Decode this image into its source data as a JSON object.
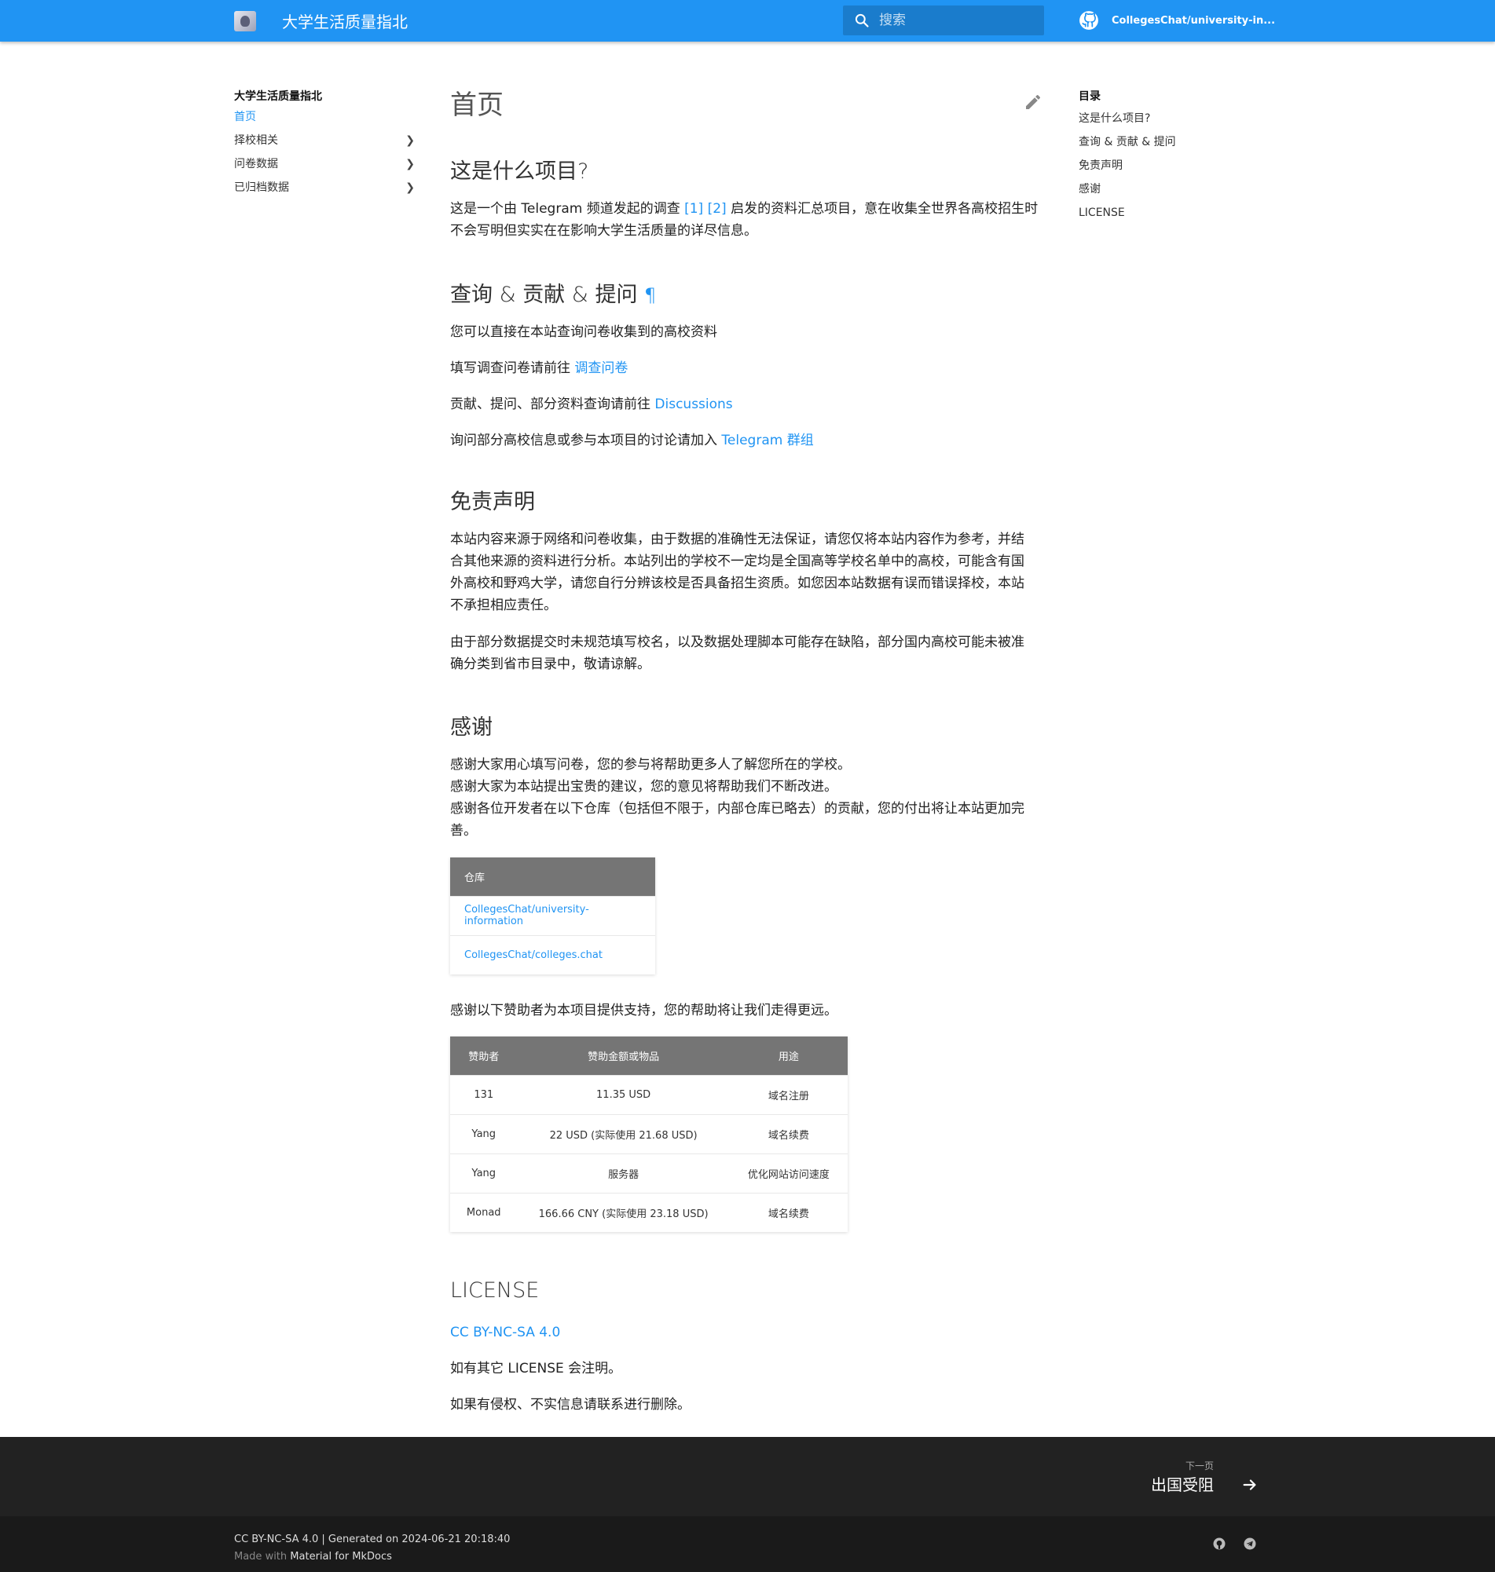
{
  "header": {
    "site_title": "大学生活质量指北",
    "search_placeholder": "搜索",
    "repo_name": "CollegesChat/university-in..."
  },
  "nav": {
    "title": "大学生活质量指北",
    "items": [
      {
        "label": "首页",
        "active": true
      },
      {
        "label": "择校相关"
      },
      {
        "label": "问卷数据"
      },
      {
        "label": "已归档数据"
      }
    ]
  },
  "toc": {
    "title": "目录",
    "items": [
      "这是什么项目?",
      "查询 & 贡献 & 提问",
      "免责声明",
      "感谢",
      "LICENSE"
    ]
  },
  "page": {
    "title": "首页",
    "s1": {
      "heading": "这是什么项目?",
      "p_pre": "这是一个由 Telegram 频道发起的调查 ",
      "link1": "[1]",
      "link2": "[2]",
      "p_line1_post": " 启发的资料汇总项目，意在收集全世界各高校招生时",
      "p_line2": "不会写明但实实在在影响大学生活质量的详尽信息。"
    },
    "s2": {
      "heading": "查询 & 贡献 & 提问",
      "pilcrow": "¶",
      "p1": "您可以直接在本站查询问卷收集到的高校资料",
      "p2_pre": "填写调查问卷请前往 ",
      "p2_link": "调查问卷",
      "p3_pre": "贡献、提问、部分资料查询请前往 ",
      "p3_link": "Discussions",
      "p4_pre": "询问部分高校信息或参与本项目的讨论请加入 ",
      "p4_link": "Telegram 群组"
    },
    "s3": {
      "heading": "免责声明",
      "p1_l1": "本站内容来源于网络和问卷收集，由于数据的准确性无法保证，请您仅将本站内容作为参考，并结",
      "p1_l2": "合其他来源的资料进行分析。本站列出的学校不一定均是全国高等学校名单中的高校，可能含有国",
      "p1_l3": "外高校和野鸡大学，请您自行分辨该校是否具备招生资质。如您因本站数据有误而错误择校，本站",
      "p1_l4": "不承担相应责任。",
      "p2_l1": "由于部分数据提交时未规范填写校名，以及数据处理脚本可能存在缺陷，部分国内高校可能未被准",
      "p2_l2": "确分类到省市目录中，敬请谅解。"
    },
    "s4": {
      "heading": "感谢",
      "l1": "感谢大家用心填写问卷，您的参与将帮助更多人了解您所在的学校。",
      "l2": "感谢大家为本站提出宝贵的建议，您的意见将帮助我们不断改进。",
      "l3": "感谢各位开发者在以下仓库（包括但不限于，内部仓库已略去）的贡献，您的付出将让本站更加完",
      "l4": "善。",
      "repo_table": {
        "header": "仓库",
        "rows": [
          "CollegesChat/university-information",
          "CollegesChat/colleges.chat"
        ]
      },
      "sponsor_intro": "感谢以下赞助者为本项目提供支持，您的帮助将让我们走得更远。",
      "sponsor_table": {
        "headers": [
          "赞助者",
          "赞助金额或物品",
          "用途"
        ],
        "rows": [
          [
            "131",
            "11.35 USD",
            "域名注册"
          ],
          [
            "Yang",
            "22 USD (实际使用 21.68 USD)",
            "域名续费"
          ],
          [
            "Yang",
            "服务器",
            "优化网站访问速度"
          ],
          [
            "Monad",
            "166.66 CNY (实际使用 23.18 USD)",
            "域名续费"
          ]
        ]
      }
    },
    "s5": {
      "heading": "LICENSE",
      "link": "CC BY-NC-SA 4.0",
      "p1": "如有其它 LICENSE 会注明。",
      "p2": "如果有侵权、不实信息请联系进行删除。"
    }
  },
  "footer": {
    "next_label": "下一页",
    "next_title": "出国受阻",
    "meta": "CC BY-NC-SA 4.0 | Generated on 2024-06-21 20:18:40",
    "made_with": "Made with",
    "made_with_link": "Material for MkDocs"
  },
  "colors": {
    "primary": "#2094f3",
    "table_header": "#757575",
    "footer_dark": "#222222",
    "footer_darker": "#1a1a1a"
  }
}
